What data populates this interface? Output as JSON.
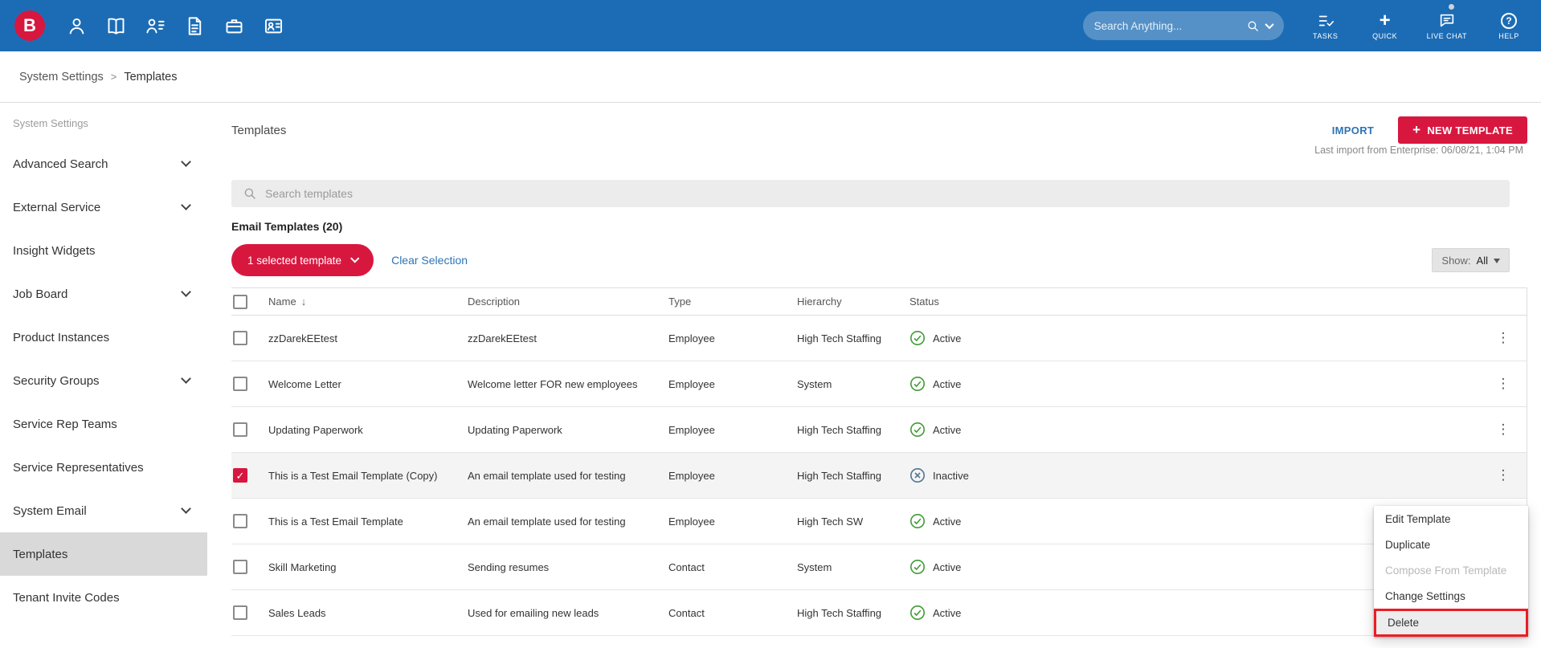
{
  "colors": {
    "topbar_blue": "#1c6cb5",
    "accent_red": "#d8173f",
    "link_blue": "#2e74b5",
    "active_green": "#3f9c35",
    "inactive_blue_gray": "#4f7793",
    "annotation_red": "#ec1c24",
    "sidebar_selected_bg": "#d9d9d9"
  },
  "icons": {
    "logo_letter": "B",
    "kebab": "⋮",
    "sort_desc": "↓",
    "breadcrumb_separator": ">",
    "plus": "+",
    "help": "?"
  },
  "topbar": {
    "search_placeholder": "Search Anything...",
    "nav_icons": [
      "person",
      "book",
      "contacts",
      "notes",
      "briefcase",
      "id-card"
    ],
    "actions": [
      {
        "label": "TASKS",
        "icon": "tasks-icon"
      },
      {
        "label": "QUICK",
        "icon": "quick-add-icon"
      },
      {
        "label": "LIVE CHAT",
        "icon": "live-chat-icon"
      },
      {
        "label": "HELP",
        "icon": "help-icon"
      }
    ]
  },
  "breadcrumb": {
    "items": [
      "System Settings",
      "Templates"
    ]
  },
  "sidebar": {
    "heading": "System Settings",
    "items": [
      {
        "label": "Advanced Search",
        "expandable": true,
        "selected": false
      },
      {
        "label": "External Service",
        "expandable": true,
        "selected": false
      },
      {
        "label": "Insight Widgets",
        "expandable": false,
        "selected": false
      },
      {
        "label": "Job Board",
        "expandable": true,
        "selected": false
      },
      {
        "label": "Product Instances",
        "expandable": false,
        "selected": false
      },
      {
        "label": "Security Groups",
        "expandable": true,
        "selected": false
      },
      {
        "label": "Service Rep Teams",
        "expandable": false,
        "selected": false
      },
      {
        "label": "Service Representatives",
        "expandable": false,
        "selected": false
      },
      {
        "label": "System Email",
        "expandable": true,
        "selected": false
      },
      {
        "label": "Templates",
        "expandable": false,
        "selected": true
      },
      {
        "label": "Tenant Invite Codes",
        "expandable": false,
        "selected": false
      }
    ]
  },
  "main": {
    "title": "Templates",
    "import_label": "IMPORT",
    "new_template_label": "NEW TEMPLATE",
    "last_import": "Last import from Enterprise: 06/08/21, 1:04 PM",
    "search_placeholder": "Search templates",
    "section_title": "Email Templates (20)",
    "selected_pill": "1 selected template",
    "clear_selection": "Clear Selection",
    "show_label": "Show:",
    "show_value": "All"
  },
  "table": {
    "columns": [
      "Name",
      "Description",
      "Type",
      "Hierarchy",
      "Status"
    ],
    "rows": [
      {
        "name": "zzDarekEEtest",
        "description": "zzDarekEEtest",
        "type": "Employee",
        "hierarchy": "High Tech Staffing",
        "status": "Active",
        "checked": false
      },
      {
        "name": "Welcome Letter",
        "description": "Welcome letter FOR new employees",
        "type": "Employee",
        "hierarchy": "System",
        "status": "Active",
        "checked": false
      },
      {
        "name": "Updating Paperwork",
        "description": "Updating Paperwork",
        "type": "Employee",
        "hierarchy": "High Tech Staffing",
        "status": "Active",
        "checked": false
      },
      {
        "name": "This is a Test Email Template (Copy)",
        "description": "An email template used for testing",
        "type": "Employee",
        "hierarchy": "High Tech Staffing",
        "status": "Inactive",
        "checked": true
      },
      {
        "name": "This is a Test Email Template",
        "description": "An email template used for testing",
        "type": "Employee",
        "hierarchy": "High Tech SW",
        "status": "Active",
        "checked": false
      },
      {
        "name": "Skill Marketing",
        "description": "Sending resumes",
        "type": "Contact",
        "hierarchy": "System",
        "status": "Active",
        "checked": false
      },
      {
        "name": "Sales Leads",
        "description": "Used for emailing new leads",
        "type": "Contact",
        "hierarchy": "High Tech Staffing",
        "status": "Active",
        "checked": false
      }
    ]
  },
  "context_menu": {
    "items": [
      {
        "label": "Edit Template",
        "disabled": false,
        "highlighted": false
      },
      {
        "label": "Duplicate",
        "disabled": false,
        "highlighted": false
      },
      {
        "label": "Compose From Template",
        "disabled": true,
        "highlighted": false
      },
      {
        "label": "Change Settings",
        "disabled": false,
        "highlighted": false
      },
      {
        "label": "Delete",
        "disabled": false,
        "highlighted": true
      }
    ]
  }
}
